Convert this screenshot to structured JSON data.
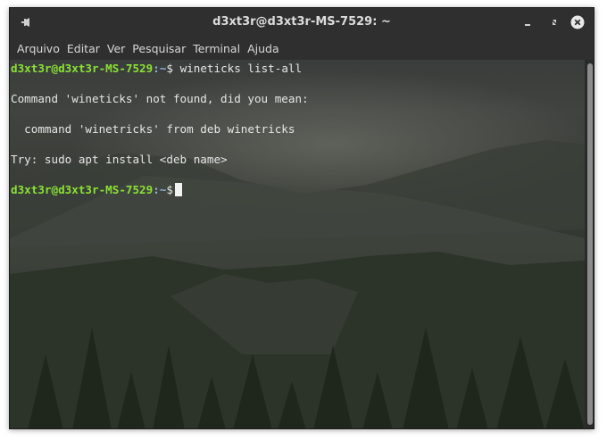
{
  "window": {
    "title": "d3xt3r@d3xt3r-MS-7529: ~"
  },
  "menubar": {
    "items": [
      "Arquivo",
      "Editar",
      "Ver",
      "Pesquisar",
      "Terminal",
      "Ajuda"
    ]
  },
  "terminal": {
    "prompt_user": "d3xt3r@d3xt3r-MS-7529",
    "prompt_path": ":~",
    "prompt_symbol": "$",
    "command": " wineticks list-all",
    "output": {
      "not_found": "Command 'wineticks' not found, did you mean:",
      "suggestion": "  command 'winetricks' from deb winetricks",
      "try": "Try: sudo apt install <deb name>"
    }
  },
  "colors": {
    "prompt_user": "#8ae234",
    "prompt_path": "#8fb0d8",
    "text": "#e6e6e6",
    "titlebar": "#2f2f2f"
  },
  "icons": {
    "pin": "pin-icon",
    "minimize": "minimize-icon",
    "maximize": "maximize-icon",
    "close": "close-icon"
  }
}
